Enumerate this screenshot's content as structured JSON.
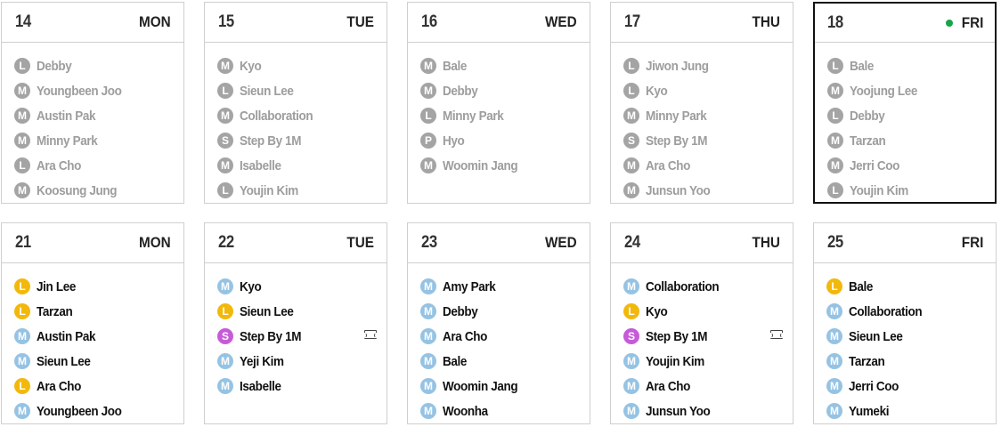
{
  "weeks": [
    [
      {
        "date": "14",
        "weekday": "MON",
        "state": "past",
        "entries": [
          {
            "type": "L",
            "name": "Debby"
          },
          {
            "type": "M",
            "name": "Youngbeen Joo"
          },
          {
            "type": "M",
            "name": "Austin Pak"
          },
          {
            "type": "M",
            "name": "Minny Park"
          },
          {
            "type": "L",
            "name": "Ara Cho"
          },
          {
            "type": "M",
            "name": "Koosung Jung"
          }
        ]
      },
      {
        "date": "15",
        "weekday": "TUE",
        "state": "past",
        "entries": [
          {
            "type": "M",
            "name": "Kyo"
          },
          {
            "type": "L",
            "name": "Sieun Lee"
          },
          {
            "type": "M",
            "name": "Collaboration"
          },
          {
            "type": "S",
            "name": "Step By 1M"
          },
          {
            "type": "M",
            "name": "Isabelle"
          },
          {
            "type": "L",
            "name": "Youjin Kim"
          }
        ]
      },
      {
        "date": "16",
        "weekday": "WED",
        "state": "past",
        "entries": [
          {
            "type": "M",
            "name": "Bale"
          },
          {
            "type": "M",
            "name": "Debby"
          },
          {
            "type": "L",
            "name": "Minny Park"
          },
          {
            "type": "P",
            "name": "Hyo"
          },
          {
            "type": "M",
            "name": "Woomin Jang"
          }
        ]
      },
      {
        "date": "17",
        "weekday": "THU",
        "state": "past",
        "entries": [
          {
            "type": "L",
            "name": "Jiwon Jung"
          },
          {
            "type": "L",
            "name": "Kyo"
          },
          {
            "type": "M",
            "name": "Minny Park"
          },
          {
            "type": "S",
            "name": "Step By 1M"
          },
          {
            "type": "M",
            "name": "Ara Cho"
          },
          {
            "type": "M",
            "name": "Junsun Yoo"
          }
        ]
      },
      {
        "date": "18",
        "weekday": "FRI",
        "state": "today",
        "entries": [
          {
            "type": "L",
            "name": "Bale"
          },
          {
            "type": "M",
            "name": "Yoojung Lee"
          },
          {
            "type": "L",
            "name": "Debby"
          },
          {
            "type": "M",
            "name": "Tarzan"
          },
          {
            "type": "M",
            "name": "Jerri Coo"
          },
          {
            "type": "L",
            "name": "Youjin Kim"
          }
        ]
      }
    ],
    [
      {
        "date": "21",
        "weekday": "MON",
        "state": "future",
        "entries": [
          {
            "type": "L",
            "name": "Jin Lee"
          },
          {
            "type": "L",
            "name": "Tarzan"
          },
          {
            "type": "M",
            "name": "Austin Pak"
          },
          {
            "type": "M",
            "name": "Sieun Lee"
          },
          {
            "type": "L",
            "name": "Ara Cho"
          },
          {
            "type": "M",
            "name": "Youngbeen Joo"
          }
        ]
      },
      {
        "date": "22",
        "weekday": "TUE",
        "state": "future",
        "entries": [
          {
            "type": "M",
            "name": "Kyo"
          },
          {
            "type": "L",
            "name": "Sieun Lee"
          },
          {
            "type": "S",
            "name": "Step By 1M",
            "ticket": true
          },
          {
            "type": "M",
            "name": "Yeji Kim"
          },
          {
            "type": "M",
            "name": "Isabelle"
          }
        ]
      },
      {
        "date": "23",
        "weekday": "WED",
        "state": "future",
        "entries": [
          {
            "type": "M",
            "name": "Amy Park"
          },
          {
            "type": "M",
            "name": "Debby"
          },
          {
            "type": "M",
            "name": "Ara Cho"
          },
          {
            "type": "M",
            "name": "Bale"
          },
          {
            "type": "M",
            "name": "Woomin Jang"
          },
          {
            "type": "M",
            "name": "Woonha"
          }
        ]
      },
      {
        "date": "24",
        "weekday": "THU",
        "state": "future",
        "entries": [
          {
            "type": "M",
            "name": "Collaboration"
          },
          {
            "type": "L",
            "name": "Kyo"
          },
          {
            "type": "S",
            "name": "Step By 1M",
            "ticket": true
          },
          {
            "type": "M",
            "name": "Youjin Kim"
          },
          {
            "type": "M",
            "name": "Ara Cho"
          },
          {
            "type": "M",
            "name": "Junsun Yoo"
          }
        ]
      },
      {
        "date": "25",
        "weekday": "FRI",
        "state": "future",
        "entries": [
          {
            "type": "L",
            "name": "Bale"
          },
          {
            "type": "M",
            "name": "Collaboration"
          },
          {
            "type": "M",
            "name": "Sieun Lee"
          },
          {
            "type": "M",
            "name": "Tarzan"
          },
          {
            "type": "M",
            "name": "Jerri Coo"
          },
          {
            "type": "M",
            "name": "Yumeki"
          }
        ]
      }
    ]
  ],
  "colors": {
    "L": "#f2b90c",
    "M": "#96c3e3",
    "S": "#c65bd8",
    "P": "#a4a4a4",
    "past": "#a4a4a4",
    "today_dot": "#19a34a"
  },
  "icons": {
    "ticket": "ticket-icon",
    "live": "live-dot-icon"
  }
}
